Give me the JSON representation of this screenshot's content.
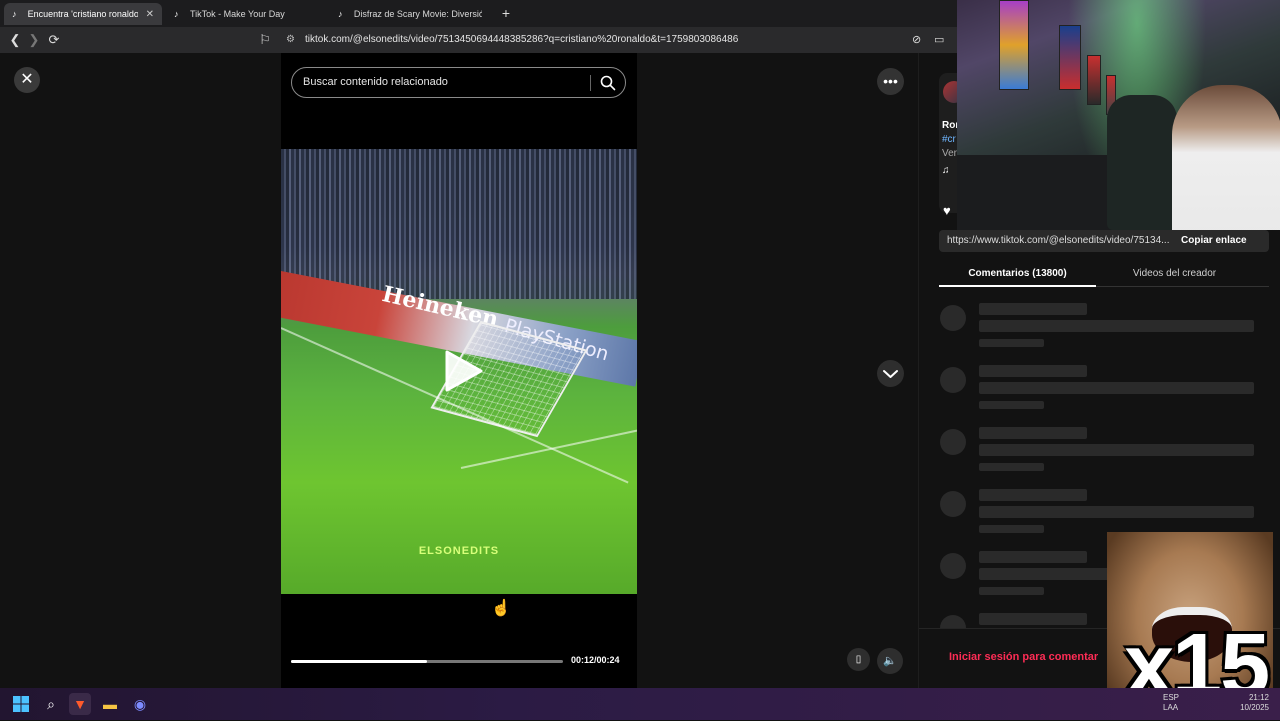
{
  "browser": {
    "tabs": [
      {
        "label": "Encuentra 'cristiano ronaldo' en",
        "active": true
      },
      {
        "label": "TikTok - Make Your Day",
        "active": false
      },
      {
        "label": "Disfraz de Scary Movie: Diversión y C",
        "active": false
      }
    ],
    "url": "tiktok.com/@elsonedits/video/7513450694448385286?q=cristiano%20ronaldo&t=1759803086486"
  },
  "page": {
    "search_placeholder": "Buscar contenido relacionado",
    "video_watermark": "ELSONEDITS",
    "ad_text_1": "Heineken",
    "ad_text_2": "PlayStation",
    "time_display": "00:12/00:24",
    "progress_fraction": 0.5
  },
  "side": {
    "author_fragment": "Ror",
    "hashtag_fragment": "#cr",
    "meta_fragment": "Ver",
    "music_glyph": "♫",
    "link_url": "https://www.tiktok.com/@elsonedits/video/75134...",
    "copy_link": "Copiar enlace",
    "tab_comments": "Comentarios (13800)",
    "tab_creator": "Videos del creador",
    "login_prompt": "Iniciar sesión para comentar"
  },
  "overlays": {
    "reaction_text": "x15"
  },
  "taskbar": {
    "lang": "ESP\nLAA",
    "time": "21:12",
    "date": "10/2025"
  },
  "colors": {
    "accent": "#fe2c55",
    "background": "#121212"
  }
}
